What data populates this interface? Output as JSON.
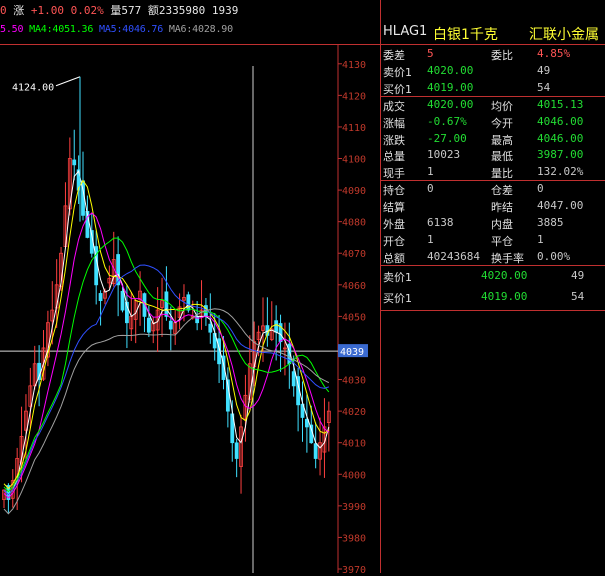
{
  "topbar": {
    "prefix": "0",
    "change_label": "涨",
    "change_value": "+1.00",
    "change_pct": "0.02%",
    "volume_label": "量",
    "volume": "577",
    "amount_label": "额",
    "amount": "2335980",
    "count": "1939"
  },
  "ma": {
    "ma3": "5.50",
    "ma4_label": "MA4:",
    "ma4": "4051.36",
    "ma5_label": "MA5:",
    "ma5": "4046.76",
    "ma6_label": "MA6:",
    "ma6": "4028.90"
  },
  "chart_data": {
    "type": "candlestick",
    "peak_annotation": "4124.00",
    "current_price_tag": "4039",
    "yticks": [
      "4130",
      "4120",
      "4110",
      "4100",
      "4090",
      "4080",
      "4070",
      "4060",
      "4050",
      "4040",
      "4030",
      "4020",
      "4010",
      "4000",
      "3990",
      "3980",
      "3970"
    ],
    "ylim": [
      3970,
      4135
    ],
    "colors": {
      "up": "#ff4040",
      "down": "#40e0ff",
      "ma1": "#ffffff",
      "ma2": "#ffff00",
      "ma3": "#ff00ff",
      "ma4": "#00ff00",
      "ma5": "#3050ff",
      "ma6": "#a0a0a0"
    }
  },
  "panel": {
    "code": "HLAG1",
    "name": "白银1千克",
    "exchange": "汇联小金属",
    "rows": [
      {
        "l1": "委差",
        "v1": "5",
        "c1": "c-red",
        "l2": "委比",
        "v2": "4.85%",
        "c2": "c-red"
      },
      {
        "l1": "卖价1",
        "v1": "4020.00",
        "c1": "c-green",
        "l2": "",
        "v2": "49",
        "c2": "c-gray"
      },
      {
        "l1": "买价1",
        "v1": "4019.00",
        "c1": "c-green",
        "l2": "",
        "v2": "54",
        "c2": "c-gray"
      },
      {
        "l1": "成交",
        "v1": "4020.00",
        "c1": "c-green",
        "l2": "均价",
        "v2": "4015.13",
        "c2": "c-green"
      },
      {
        "l1": "涨幅",
        "v1": "-0.67%",
        "c1": "c-green",
        "l2": "今开",
        "v2": "4046.00",
        "c2": "c-green"
      },
      {
        "l1": "涨跌",
        "v1": "-27.00",
        "c1": "c-green",
        "l2": "最高",
        "v2": "4046.00",
        "c2": "c-green"
      },
      {
        "l1": "总量",
        "v1": "10023",
        "c1": "c-gray",
        "l2": "最低",
        "v2": "3987.00",
        "c2": "c-green"
      },
      {
        "l1": "现手",
        "v1": "1",
        "c1": "c-gray",
        "l2": "量比",
        "v2": "132.02%",
        "c2": "c-gray"
      },
      {
        "l1": "持仓",
        "v1": "0",
        "c1": "c-gray",
        "l2": "仓差",
        "v2": "0",
        "c2": "c-gray"
      },
      {
        "l1": "结算",
        "v1": "",
        "c1": "c-gray",
        "l2": "昨结",
        "v2": "4047.00",
        "c2": "c-gray"
      },
      {
        "l1": "外盘",
        "v1": "6138",
        "c1": "c-gray",
        "l2": "内盘",
        "v2": "3885",
        "c2": "c-gray"
      },
      {
        "l1": "开仓",
        "v1": "1",
        "c1": "c-gray",
        "l2": "平仓",
        "v2": "1",
        "c2": "c-gray"
      },
      {
        "l1": "总额",
        "v1": "40243684",
        "c1": "c-gray",
        "l2": "换手率",
        "v2": "0.00%",
        "c2": "c-gray"
      }
    ],
    "book": [
      {
        "l": "卖价1",
        "p": "4020.00",
        "q": "49"
      },
      {
        "l": "买价1",
        "p": "4019.00",
        "q": "54"
      }
    ]
  }
}
